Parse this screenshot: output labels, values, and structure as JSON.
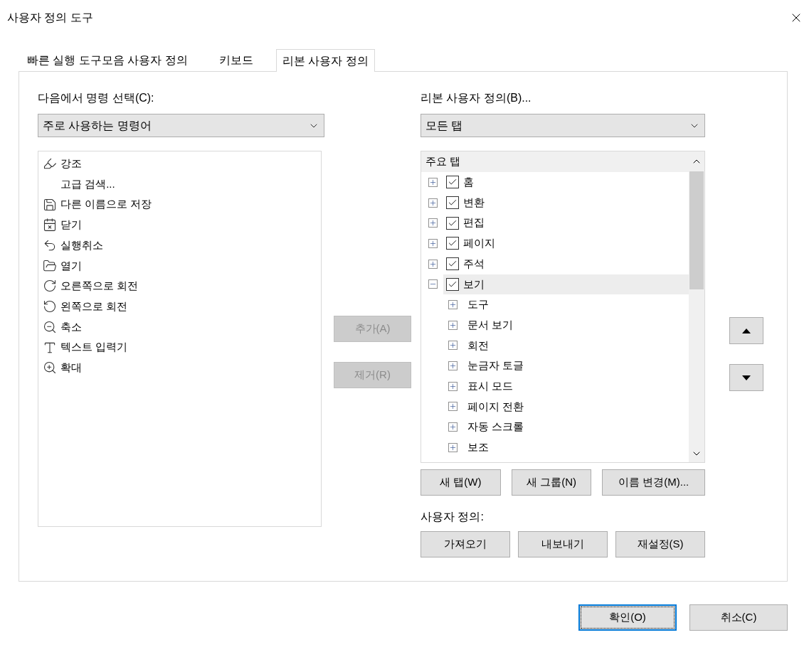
{
  "window": {
    "title": "사용자 정의 도구"
  },
  "tabs": [
    {
      "label": "빠른 실행 도구모음 사용자 정의",
      "selected": false
    },
    {
      "label": "키보드",
      "selected": false
    },
    {
      "label": "리본 사용자 정의",
      "selected": true
    }
  ],
  "left": {
    "label": "다음에서 명령 선택(C):",
    "dropdown": {
      "value": "주로 사용하는 명령어"
    },
    "commands": [
      "강조",
      "고급 검색...",
      "다른 이름으로 저장",
      "닫기",
      "실행취소",
      "열기",
      "오른쪽으로 회전",
      "왼쪽으로 회전",
      "축소",
      "텍스트 입력기",
      "확대"
    ]
  },
  "middle_buttons": [
    {
      "label": "추가(A)",
      "disabled": true
    },
    {
      "label": "제거(R)",
      "disabled": true
    }
  ],
  "right": {
    "label": "리본 사용자 정의(B)...",
    "dropdown": {
      "value": "모든 탭"
    },
    "tree": {
      "header": "주요 탭",
      "items": [
        {
          "label": "홈",
          "checked": true,
          "expanded": false,
          "selected": false
        },
        {
          "label": "변환",
          "checked": true,
          "expanded": false,
          "selected": false
        },
        {
          "label": "편집",
          "checked": true,
          "expanded": false,
          "selected": false
        },
        {
          "label": "페이지",
          "checked": true,
          "expanded": false,
          "selected": false
        },
        {
          "label": "주석",
          "checked": true,
          "expanded": false,
          "selected": false
        },
        {
          "label": "보기",
          "checked": true,
          "expanded": true,
          "selected": true,
          "children": [
            {
              "label": "도구",
              "expanded": false
            },
            {
              "label": "문서 보기",
              "expanded": false
            },
            {
              "label": "회전",
              "expanded": false
            },
            {
              "label": "눈금자 토글",
              "expanded": false
            },
            {
              "label": "표시 모드",
              "expanded": false
            },
            {
              "label": "페이지 전환",
              "expanded": false
            },
            {
              "label": "자동 스크롤",
              "expanded": false
            },
            {
              "label": "보조",
              "expanded": false
            }
          ]
        }
      ]
    }
  },
  "tree_buttons": [
    "새 탭(W)",
    "새 그룹(N)",
    "이름 변경(M)..."
  ],
  "customize": {
    "label": "사용자 정의:",
    "buttons": [
      "가져오기",
      "내보내기",
      "재설정(S)"
    ]
  },
  "footer": [
    {
      "label": "확인(O)",
      "default": true
    },
    {
      "label": "취소(C)",
      "default": false
    }
  ]
}
